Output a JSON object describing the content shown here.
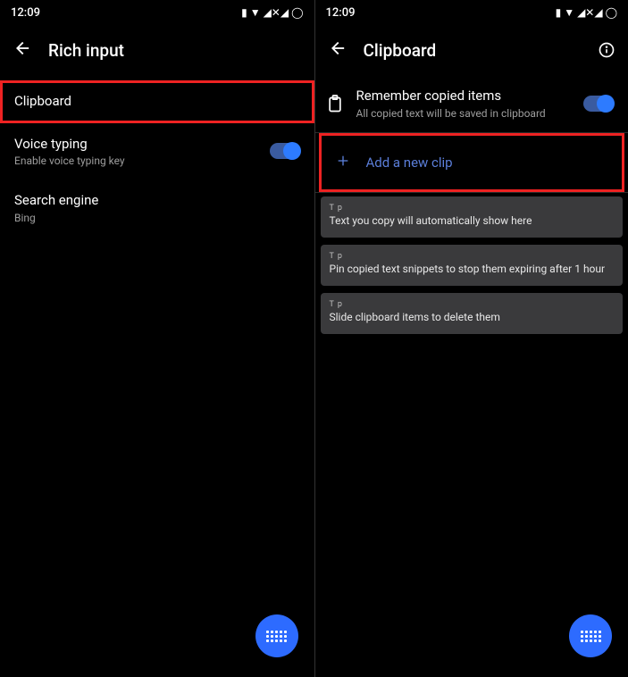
{
  "left": {
    "status": {
      "time": "12:09",
      "icons": "▮ ▼ ◢✕◢ ◯"
    },
    "header": {
      "title": "Rich input"
    },
    "items": {
      "clipboard": {
        "label": "Clipboard"
      },
      "voice": {
        "label": "Voice typing",
        "sub": "Enable voice typing key"
      },
      "search": {
        "label": "Search engine",
        "sub": "Bing"
      }
    }
  },
  "right": {
    "status": {
      "time": "12:09",
      "icons": "▮ ▼ ◢✕◢ ◯"
    },
    "header": {
      "title": "Clipboard"
    },
    "remember": {
      "label": "Remember copied items",
      "sub": "All copied text will be saved in clipboard"
    },
    "addClip": {
      "label": "Add a new clip"
    },
    "tips": [
      {
        "tag": "T p",
        "msg": "Text you copy will automatically show here"
      },
      {
        "tag": "T p",
        "msg": "Pin copied text snippets to stop them expiring after 1 hour"
      },
      {
        "tag": "T p",
        "msg": "Slide clipboard items to delete them"
      }
    ]
  }
}
